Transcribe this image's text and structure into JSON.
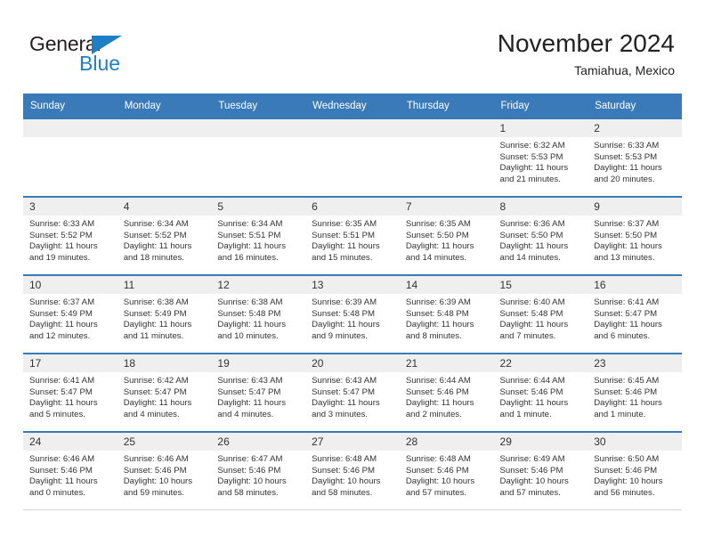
{
  "brand": {
    "name_top": "General",
    "name_bottom": "Blue",
    "triangle_color": "#1f7fc4"
  },
  "header": {
    "title": "November 2024",
    "subtitle": "Tamiahua, Mexico"
  },
  "colors": {
    "header_blue": "#3b7ab9",
    "daynum_band": "#efefef",
    "text": "#333333"
  },
  "weekday_headers": [
    "Sunday",
    "Monday",
    "Tuesday",
    "Wednesday",
    "Thursday",
    "Friday",
    "Saturday"
  ],
  "labels": {
    "sunrise_prefix": "Sunrise:",
    "sunset_prefix": "Sunset:",
    "daylight_prefix": "Daylight:"
  },
  "weeks": [
    [
      {
        "day": "",
        "empty": true
      },
      {
        "day": "",
        "empty": true
      },
      {
        "day": "",
        "empty": true
      },
      {
        "day": "",
        "empty": true
      },
      {
        "day": "",
        "empty": true
      },
      {
        "day": "1",
        "sunrise": "Sunrise: 6:32 AM",
        "sunset": "Sunset: 5:53 PM",
        "daylight": "Daylight: 11 hours and 21 minutes."
      },
      {
        "day": "2",
        "sunrise": "Sunrise: 6:33 AM",
        "sunset": "Sunset: 5:53 PM",
        "daylight": "Daylight: 11 hours and 20 minutes."
      }
    ],
    [
      {
        "day": "3",
        "sunrise": "Sunrise: 6:33 AM",
        "sunset": "Sunset: 5:52 PM",
        "daylight": "Daylight: 11 hours and 19 minutes."
      },
      {
        "day": "4",
        "sunrise": "Sunrise: 6:34 AM",
        "sunset": "Sunset: 5:52 PM",
        "daylight": "Daylight: 11 hours and 18 minutes."
      },
      {
        "day": "5",
        "sunrise": "Sunrise: 6:34 AM",
        "sunset": "Sunset: 5:51 PM",
        "daylight": "Daylight: 11 hours and 16 minutes."
      },
      {
        "day": "6",
        "sunrise": "Sunrise: 6:35 AM",
        "sunset": "Sunset: 5:51 PM",
        "daylight": "Daylight: 11 hours and 15 minutes."
      },
      {
        "day": "7",
        "sunrise": "Sunrise: 6:35 AM",
        "sunset": "Sunset: 5:50 PM",
        "daylight": "Daylight: 11 hours and 14 minutes."
      },
      {
        "day": "8",
        "sunrise": "Sunrise: 6:36 AM",
        "sunset": "Sunset: 5:50 PM",
        "daylight": "Daylight: 11 hours and 14 minutes."
      },
      {
        "day": "9",
        "sunrise": "Sunrise: 6:37 AM",
        "sunset": "Sunset: 5:50 PM",
        "daylight": "Daylight: 11 hours and 13 minutes."
      }
    ],
    [
      {
        "day": "10",
        "sunrise": "Sunrise: 6:37 AM",
        "sunset": "Sunset: 5:49 PM",
        "daylight": "Daylight: 11 hours and 12 minutes."
      },
      {
        "day": "11",
        "sunrise": "Sunrise: 6:38 AM",
        "sunset": "Sunset: 5:49 PM",
        "daylight": "Daylight: 11 hours and 11 minutes."
      },
      {
        "day": "12",
        "sunrise": "Sunrise: 6:38 AM",
        "sunset": "Sunset: 5:48 PM",
        "daylight": "Daylight: 11 hours and 10 minutes."
      },
      {
        "day": "13",
        "sunrise": "Sunrise: 6:39 AM",
        "sunset": "Sunset: 5:48 PM",
        "daylight": "Daylight: 11 hours and 9 minutes."
      },
      {
        "day": "14",
        "sunrise": "Sunrise: 6:39 AM",
        "sunset": "Sunset: 5:48 PM",
        "daylight": "Daylight: 11 hours and 8 minutes."
      },
      {
        "day": "15",
        "sunrise": "Sunrise: 6:40 AM",
        "sunset": "Sunset: 5:48 PM",
        "daylight": "Daylight: 11 hours and 7 minutes."
      },
      {
        "day": "16",
        "sunrise": "Sunrise: 6:41 AM",
        "sunset": "Sunset: 5:47 PM",
        "daylight": "Daylight: 11 hours and 6 minutes."
      }
    ],
    [
      {
        "day": "17",
        "sunrise": "Sunrise: 6:41 AM",
        "sunset": "Sunset: 5:47 PM",
        "daylight": "Daylight: 11 hours and 5 minutes."
      },
      {
        "day": "18",
        "sunrise": "Sunrise: 6:42 AM",
        "sunset": "Sunset: 5:47 PM",
        "daylight": "Daylight: 11 hours and 4 minutes."
      },
      {
        "day": "19",
        "sunrise": "Sunrise: 6:43 AM",
        "sunset": "Sunset: 5:47 PM",
        "daylight": "Daylight: 11 hours and 4 minutes."
      },
      {
        "day": "20",
        "sunrise": "Sunrise: 6:43 AM",
        "sunset": "Sunset: 5:47 PM",
        "daylight": "Daylight: 11 hours and 3 minutes."
      },
      {
        "day": "21",
        "sunrise": "Sunrise: 6:44 AM",
        "sunset": "Sunset: 5:46 PM",
        "daylight": "Daylight: 11 hours and 2 minutes."
      },
      {
        "day": "22",
        "sunrise": "Sunrise: 6:44 AM",
        "sunset": "Sunset: 5:46 PM",
        "daylight": "Daylight: 11 hours and 1 minute."
      },
      {
        "day": "23",
        "sunrise": "Sunrise: 6:45 AM",
        "sunset": "Sunset: 5:46 PM",
        "daylight": "Daylight: 11 hours and 1 minute."
      }
    ],
    [
      {
        "day": "24",
        "sunrise": "Sunrise: 6:46 AM",
        "sunset": "Sunset: 5:46 PM",
        "daylight": "Daylight: 11 hours and 0 minutes."
      },
      {
        "day": "25",
        "sunrise": "Sunrise: 6:46 AM",
        "sunset": "Sunset: 5:46 PM",
        "daylight": "Daylight: 10 hours and 59 minutes."
      },
      {
        "day": "26",
        "sunrise": "Sunrise: 6:47 AM",
        "sunset": "Sunset: 5:46 PM",
        "daylight": "Daylight: 10 hours and 58 minutes."
      },
      {
        "day": "27",
        "sunrise": "Sunrise: 6:48 AM",
        "sunset": "Sunset: 5:46 PM",
        "daylight": "Daylight: 10 hours and 58 minutes."
      },
      {
        "day": "28",
        "sunrise": "Sunrise: 6:48 AM",
        "sunset": "Sunset: 5:46 PM",
        "daylight": "Daylight: 10 hours and 57 minutes."
      },
      {
        "day": "29",
        "sunrise": "Sunrise: 6:49 AM",
        "sunset": "Sunset: 5:46 PM",
        "daylight": "Daylight: 10 hours and 57 minutes."
      },
      {
        "day": "30",
        "sunrise": "Sunrise: 6:50 AM",
        "sunset": "Sunset: 5:46 PM",
        "daylight": "Daylight: 10 hours and 56 minutes."
      }
    ]
  ]
}
